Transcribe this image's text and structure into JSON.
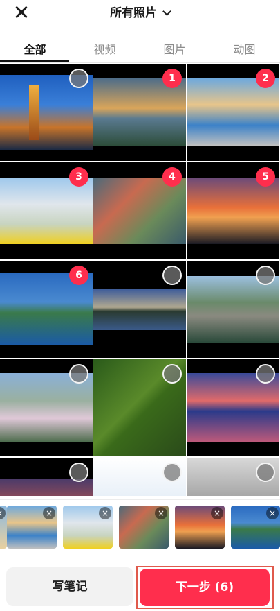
{
  "header": {
    "close_icon": "close-icon",
    "album_title": "所有照片",
    "dropdown_icon": "chevron-down-icon"
  },
  "tabs": [
    {
      "label": "全部",
      "active": true
    },
    {
      "label": "视频",
      "active": false
    },
    {
      "label": "图片",
      "active": false
    },
    {
      "label": "动图",
      "active": false
    }
  ],
  "grid": {
    "photos": [
      {
        "subject": "pagoda at dusk",
        "selected": false,
        "order": ""
      },
      {
        "subject": "river sunset",
        "selected": true,
        "order": "1"
      },
      {
        "subject": "theme park mascots",
        "selected": true,
        "order": "2"
      },
      {
        "subject": "colorful theme park",
        "selected": true,
        "order": "3"
      },
      {
        "subject": "aerial theme park",
        "selected": true,
        "order": "4"
      },
      {
        "subject": "pagoda sunset",
        "selected": true,
        "order": "5"
      },
      {
        "subject": "aerial island",
        "selected": true,
        "order": "6"
      },
      {
        "subject": "lake reflection",
        "selected": false,
        "order": ""
      },
      {
        "subject": "arch bridge",
        "selected": false,
        "order": ""
      },
      {
        "subject": "cherry blossom aerial",
        "selected": false,
        "order": ""
      },
      {
        "subject": "aerial forest",
        "selected": false,
        "order": ""
      },
      {
        "subject": "building reflection dusk",
        "selected": false,
        "order": ""
      },
      {
        "subject": "sunset partial",
        "selected": false,
        "order": ""
      },
      {
        "subject": "poster screenshot",
        "selected": false,
        "order": ""
      },
      {
        "subject": "street buildings",
        "selected": false,
        "order": ""
      }
    ]
  },
  "tray": {
    "remove_symbol": "×",
    "items": [
      "theme park mascots",
      "colorful theme park",
      "aerial theme park",
      "pagoda sunset",
      "aerial island"
    ]
  },
  "footer": {
    "note_label": "写笔记",
    "next_label": "下一步 (6)"
  },
  "colors": {
    "accent": "#ff2e4d",
    "highlight_frame": "#e05a4c"
  }
}
